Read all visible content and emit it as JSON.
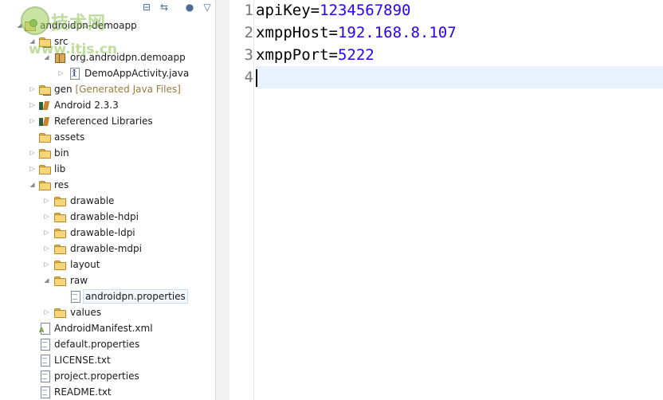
{
  "explorer": {
    "tree": [
      {
        "label": "androidpn-demoapp",
        "icon": "project-icon",
        "twisty": "expanded"
      },
      {
        "label": "src",
        "icon": "source-folder-icon",
        "twisty": "expanded"
      },
      {
        "label": "org.androidpn.demoapp",
        "icon": "package-icon",
        "twisty": "expanded"
      },
      {
        "label": "DemoAppActivity.java",
        "icon": "java-file-icon",
        "twisty": "collapsed"
      },
      {
        "label": "gen",
        "decoration": "[Generated Java Files]",
        "icon": "source-folder-icon",
        "twisty": "collapsed"
      },
      {
        "label": "Android 2.3.3",
        "icon": "library-icon",
        "twisty": "collapsed"
      },
      {
        "label": "Referenced Libraries",
        "icon": "library-icon",
        "twisty": "collapsed"
      },
      {
        "label": "assets",
        "icon": "folder-icon",
        "twisty": "none"
      },
      {
        "label": "bin",
        "icon": "folder-icon",
        "twisty": "collapsed"
      },
      {
        "label": "lib",
        "icon": "folder-icon",
        "twisty": "collapsed"
      },
      {
        "label": "res",
        "icon": "folder-icon",
        "twisty": "expanded"
      },
      {
        "label": "drawable",
        "icon": "folder-icon",
        "twisty": "collapsed"
      },
      {
        "label": "drawable-hdpi",
        "icon": "folder-icon",
        "twisty": "collapsed"
      },
      {
        "label": "drawable-ldpi",
        "icon": "folder-icon",
        "twisty": "collapsed"
      },
      {
        "label": "drawable-mdpi",
        "icon": "folder-icon",
        "twisty": "collapsed"
      },
      {
        "label": "layout",
        "icon": "folder-icon",
        "twisty": "collapsed"
      },
      {
        "label": "raw",
        "icon": "folder-icon",
        "twisty": "expanded"
      },
      {
        "label": "androidpn.properties",
        "icon": "properties-file-icon",
        "twisty": "none",
        "selected": true
      },
      {
        "label": "values",
        "icon": "folder-icon",
        "twisty": "collapsed"
      },
      {
        "label": "AndroidManifest.xml",
        "icon": "android-manifest-icon",
        "twisty": "none"
      },
      {
        "label": "default.properties",
        "icon": "file-icon",
        "twisty": "none"
      },
      {
        "label": "LICENSE.txt",
        "icon": "file-icon",
        "twisty": "none"
      },
      {
        "label": "project.properties",
        "icon": "file-icon",
        "twisty": "none"
      },
      {
        "label": "README.txt",
        "icon": "file-icon",
        "twisty": "none"
      }
    ]
  },
  "watermark": {
    "text_cn": "技术网",
    "url": "www.itjs.cn"
  },
  "editor": {
    "lines": [
      {
        "number": "1",
        "key": "apiKey",
        "sep": "=",
        "value": "1234567890"
      },
      {
        "number": "2",
        "key": "xmppHost",
        "sep": "=",
        "value": "192.168.8.107"
      },
      {
        "number": "3",
        "key": "xmppPort",
        "sep": "=",
        "value": "5222"
      },
      {
        "number": "4",
        "key": "",
        "sep": "",
        "value": ""
      }
    ],
    "current_line": 4
  },
  "colors": {
    "key": "#000000",
    "value": "#2a00ff",
    "current_line_bg": "#e8f2fe"
  }
}
